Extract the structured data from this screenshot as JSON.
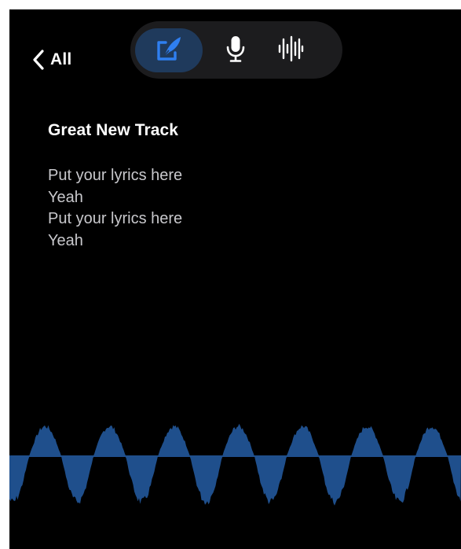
{
  "nav": {
    "back_label": "All",
    "back_icon": "chevron-left-icon"
  },
  "mode_switch": {
    "modes": [
      {
        "name": "write",
        "icon": "quill-pen-icon",
        "active": true
      },
      {
        "name": "record",
        "icon": "microphone-icon",
        "active": false
      },
      {
        "name": "waveform",
        "icon": "waveform-icon",
        "active": false
      }
    ]
  },
  "song": {
    "title": "Great New Track",
    "lyrics": [
      "Put your lyrics here",
      "Yeah",
      "Put your lyrics here",
      "Yeah"
    ]
  },
  "colors": {
    "background": "#000000",
    "accent": "#2f7ff0",
    "active_pill": "#1f3a5c",
    "waveform": "#1f4f8c",
    "pill_background": "#1c1c1e",
    "lyrics_text": "#c8c8cc"
  }
}
